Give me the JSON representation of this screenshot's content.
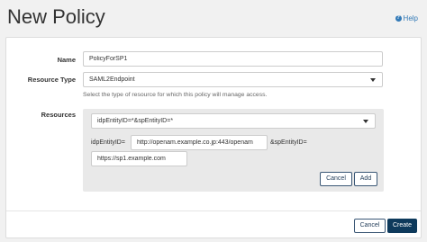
{
  "header": {
    "title": "New Policy",
    "help_label": "Help"
  },
  "form": {
    "name_label": "Name",
    "name_value": "PolicyForSP1",
    "resource_type_label": "Resource Type",
    "resource_type_value": "SAML2Endpoint",
    "resource_type_help": "Select the type of resource for which this policy will manage access.",
    "resources_label": "Resources",
    "pattern_value": "idpEntityID=*&spEntityID=*",
    "idp_prefix": "idpEntityID=",
    "idp_value": "http://openam.example.co.jp:443/openam",
    "sp_suffix": "&spEntityID=",
    "sp_value": "https://sp1.example.com",
    "panel_cancel_label": "Cancel",
    "panel_add_label": "Add"
  },
  "footer": {
    "cancel_label": "Cancel",
    "create_label": "Create"
  },
  "colors": {
    "accent": "#0e3a5c",
    "link": "#337ab7"
  }
}
